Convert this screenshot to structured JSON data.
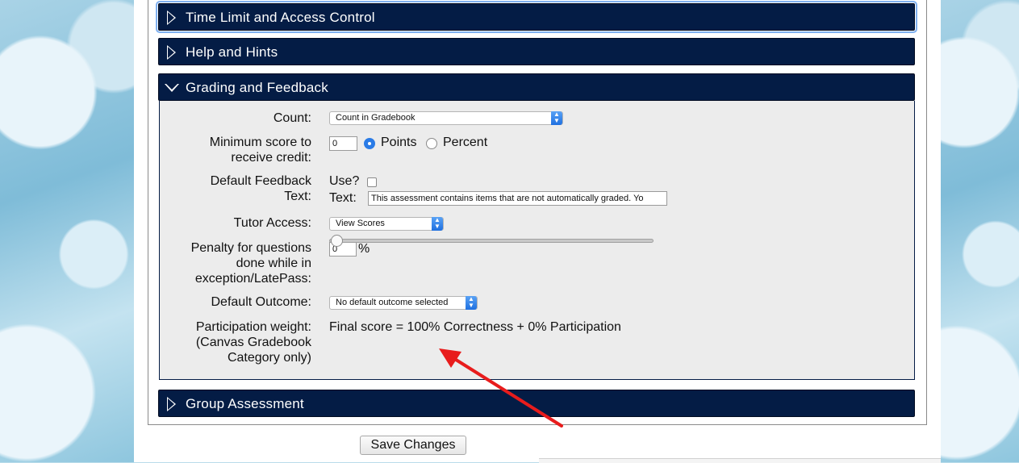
{
  "sections": {
    "time_limit": "Time Limit and Access Control",
    "help_hints": "Help and Hints",
    "grading": "Grading and Feedback",
    "group": "Group Assessment"
  },
  "grading": {
    "count": {
      "label": "Count:",
      "value": "Count in Gradebook"
    },
    "min_score": {
      "label_line1": "Minimum score to",
      "label_line2": "receive credit:",
      "value": "0",
      "option_points": "Points",
      "option_percent": "Percent",
      "selected": "Points"
    },
    "feedback": {
      "label_line1": "Default Feedback",
      "label_line2": "Text:",
      "use_label": "Use?",
      "use_checked": false,
      "text_label": "Text:",
      "text_value": "This assessment contains items that are not automatically graded.  Yo"
    },
    "tutor": {
      "label": "Tutor Access:",
      "value": "View Scores"
    },
    "penalty": {
      "label_line1": "Penalty for questions",
      "label_line2": "done while in",
      "label_line3": "exception/LatePass:",
      "value": "0",
      "unit": "%"
    },
    "outcome": {
      "label": "Default Outcome:",
      "value": "No default outcome selected"
    },
    "participation": {
      "label_line1": "Participation weight:",
      "label_line2": "(Canvas Gradebook",
      "label_line3": "Category only)",
      "summary": "Final score = 100% Correctness + 0% Participation",
      "slider_value_percent": 0
    }
  },
  "buttons": {
    "save": "Save Changes"
  },
  "colors": {
    "header_bg": "#041c45",
    "body_bg": "#ececec",
    "annotation_arrow": "#e81c1c",
    "accent": "#2a7be6"
  },
  "icons": {
    "collapsed": "triangle-right-icon",
    "expanded": "triangle-down-icon",
    "select_arrow": "select-updown-icon",
    "annotation": "red-arrow-icon"
  }
}
